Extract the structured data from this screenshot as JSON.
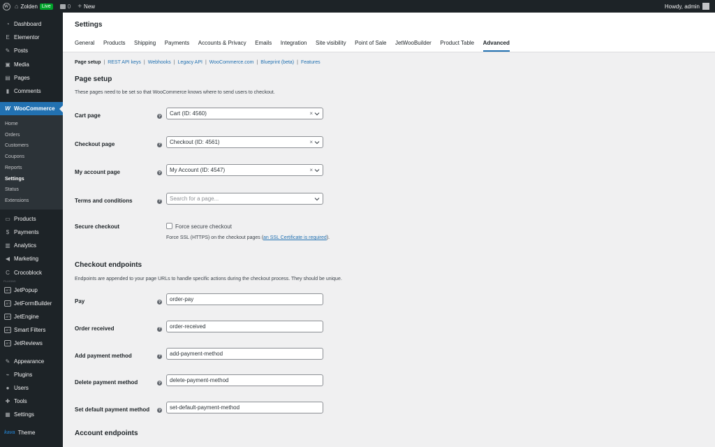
{
  "adminbar": {
    "site_name": "Zolden",
    "live_badge": "Live",
    "comments_count": "0",
    "new_label": "New",
    "howdy": "Howdy, admin"
  },
  "sidebar": {
    "items_top": [
      {
        "label": "Dashboard",
        "icon": "dashboard-icon"
      },
      {
        "label": "Elementor",
        "icon": "elementor-icon"
      },
      {
        "label": "Posts",
        "icon": "pin-icon"
      },
      {
        "label": "Media",
        "icon": "media-icon"
      },
      {
        "label": "Pages",
        "icon": "page-icon"
      },
      {
        "label": "Comments",
        "icon": "comment-icon"
      }
    ],
    "current": {
      "label": "WooCommerce",
      "icon": "woo-icon"
    },
    "submenu": [
      "Home",
      "Orders",
      "Customers",
      "Coupons",
      "Reports",
      "Settings",
      "Status",
      "Extensions"
    ],
    "items_mid": [
      {
        "label": "Products",
        "icon": "products-icon"
      },
      {
        "label": "Payments",
        "icon": "payments-icon"
      },
      {
        "label": "Analytics",
        "icon": "analytics-icon"
      },
      {
        "label": "Marketing",
        "icon": "megaphone-icon"
      },
      {
        "label": "Crocoblock",
        "icon": "crocoblock-icon"
      }
    ],
    "plugins_sep": "PLUGINS",
    "jet_items": [
      "JetPopup",
      "JetFormBuilder",
      "JetEngine",
      "Smart Filters",
      "JetReviews"
    ],
    "jet_badge": "JET",
    "items_bottom": [
      {
        "label": "Appearance",
        "icon": "brush-icon"
      },
      {
        "label": "Plugins",
        "icon": "plugin-icon"
      },
      {
        "label": "Users",
        "icon": "users-icon"
      },
      {
        "label": "Tools",
        "icon": "wrench-icon"
      },
      {
        "label": "Settings",
        "icon": "settings-icon"
      }
    ],
    "theme": {
      "badge": "kava",
      "label": "Theme"
    }
  },
  "header": {
    "title": "Settings",
    "tabs": [
      "General",
      "Products",
      "Shipping",
      "Payments",
      "Accounts & Privacy",
      "Emails",
      "Integration",
      "Site visibility",
      "Point of Sale",
      "JetWooBuilder",
      "Product Table",
      "Advanced"
    ],
    "active_tab": "Advanced"
  },
  "subsections": {
    "current": "Page setup",
    "links": [
      "REST API keys",
      "Webhooks",
      "Legacy API",
      "WooCommerce.com",
      "Blueprint (beta)",
      "Features"
    ]
  },
  "page_setup": {
    "heading": "Page setup",
    "description": "These pages need to be set so that WooCommerce knows where to send users to checkout.",
    "rows": [
      {
        "label": "Cart page",
        "value": "Cart (ID: 4560)",
        "clearable": true
      },
      {
        "label": "Checkout page",
        "value": "Checkout (ID: 4561)",
        "clearable": true
      },
      {
        "label": "My account page",
        "value": "My Account (ID: 4547)",
        "clearable": true
      },
      {
        "label": "Terms and conditions",
        "placeholder": "Search for a page...",
        "clearable": false
      }
    ],
    "secure": {
      "label": "Secure checkout",
      "checkbox_label": "Force secure checkout",
      "checked": false,
      "note_prefix": "Force SSL (HTTPS) on the checkout pages (",
      "note_link": "an SSL Certificate is required",
      "note_suffix": ")."
    }
  },
  "checkout_endpoints": {
    "heading": "Checkout endpoints",
    "description": "Endpoints are appended to your page URLs to handle specific actions during the checkout process. They should be unique.",
    "rows": [
      {
        "label": "Pay",
        "value": "order-pay"
      },
      {
        "label": "Order received",
        "value": "order-received"
      },
      {
        "label": "Add payment method",
        "value": "add-payment-method"
      },
      {
        "label": "Delete payment method",
        "value": "delete-payment-method"
      },
      {
        "label": "Set default payment method",
        "value": "set-default-payment-method"
      }
    ]
  },
  "account_endpoints": {
    "heading": "Account endpoints"
  },
  "colors": {
    "accent": "#2271b1",
    "sidebar": "#1d2327",
    "live": "#00a32a"
  }
}
